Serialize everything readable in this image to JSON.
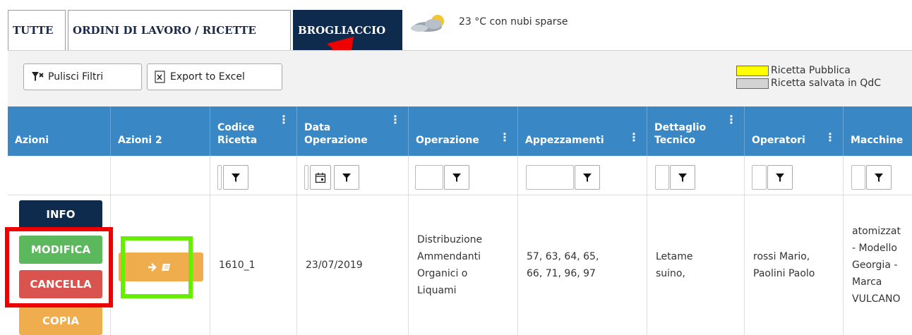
{
  "tabs": [
    {
      "label": "TUTTE"
    },
    {
      "label": "ORDINI DI LAVORO / RICETTE"
    },
    {
      "label": "BROGLIACCIO"
    }
  ],
  "weather": {
    "text": "23 °C con nubi sparse",
    "icon": "partly-cloudy-icon"
  },
  "toolbar": {
    "clear_filters": "Pulisci Filtri",
    "export_excel": "Export to Excel"
  },
  "legend": [
    {
      "label": "Ricetta Pubblica",
      "color": "#ffff00"
    },
    {
      "label": "Ricetta salvata in QdC",
      "color": "#d3d3d3"
    }
  ],
  "columns": [
    {
      "l1": "",
      "l2": "Azioni"
    },
    {
      "l1": "",
      "l2": "Azioni 2"
    },
    {
      "l1": "Codice",
      "l2": "Ricetta"
    },
    {
      "l1": "Data",
      "l2": "Operazione"
    },
    {
      "l1": "",
      "l2": "Operazione"
    },
    {
      "l1": "",
      "l2": "Appezzamenti"
    },
    {
      "l1": "Dettaglio",
      "l2": "Tecnico"
    },
    {
      "l1": "",
      "l2": "Operatori"
    },
    {
      "l1": "",
      "l2": "Macchine"
    }
  ],
  "actions": {
    "info": "INFO",
    "modifica": "MODIFICA",
    "cancella": "CANCELLA",
    "copia": "COPIA"
  },
  "row": {
    "codice": "1610_1",
    "data": "23/07/2019",
    "operazione": [
      "Distribuzione",
      "Ammendanti",
      "Organici o",
      "Liquami"
    ],
    "appezzamenti": [
      "57, 63, 64, 65,",
      "66, 71, 96, 97"
    ],
    "dettaglio": [
      "Letame",
      "suino,"
    ],
    "operatori": [
      "rossi Mario,",
      "Paolini Paolo"
    ],
    "macchine": [
      "atomizzat",
      "- Modello",
      "Georgia -",
      "Marca",
      "VULCANO"
    ]
  },
  "colors": {
    "header_blue": "#3a87c6",
    "tab_active": "#0e2a4c",
    "info": "#0e2a4c",
    "modifica": "#5cb85c",
    "cancella": "#d9534f",
    "copia": "#f0ad4e",
    "annotation_red": "#ee0000",
    "annotation_green": "#66ee00"
  }
}
